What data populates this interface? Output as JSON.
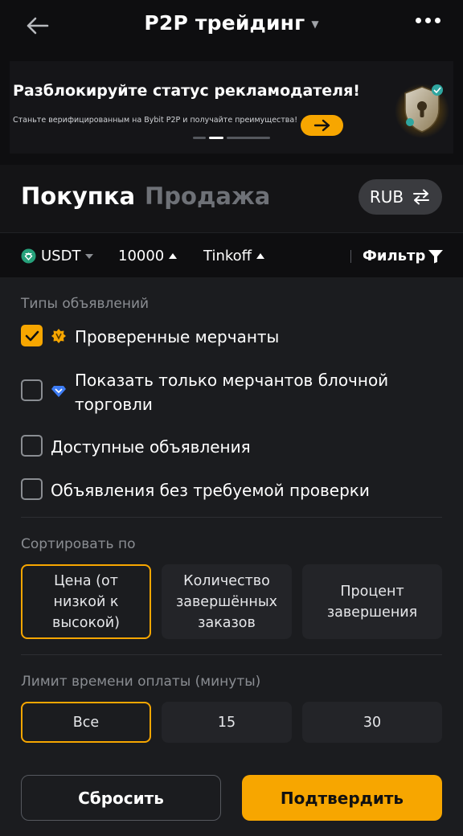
{
  "header": {
    "title": "P2P трейдинг",
    "back_icon": "arrow-left-icon",
    "more_icon": "more-horizontal-icon"
  },
  "banner": {
    "title": "Разблокируйте статус рекламодателя!",
    "subtitle": "Станьте верифицированным на Bybit P2P и получайте преимущества!",
    "cta_icon": "arrow-right-icon",
    "art_icon": "lock-badge-icon"
  },
  "tabs": {
    "buy": "Покупка",
    "sell": "Продажа",
    "active": "buy"
  },
  "currency": {
    "label": "RUB",
    "icon": "swap-icon"
  },
  "filters": {
    "coin": "USDT",
    "amount": "10000",
    "payment": "Tinkoff",
    "filter_label": "Фильтр"
  },
  "ad_types": {
    "label": "Типы объявлений",
    "items": [
      {
        "label": "Проверенные мерчанты",
        "checked": true
      },
      {
        "label": "Показать только мерчантов блочной торговли",
        "checked": false
      },
      {
        "label": "Доступные объявления",
        "checked": false
      },
      {
        "label": "Объявления без требуемой проверки",
        "checked": false
      }
    ]
  },
  "sort": {
    "label": "Сортировать по",
    "options": [
      "Цена (от низкой к высокой)",
      "Количество завершённых заказов",
      "Процент завершения"
    ],
    "selected": 0
  },
  "time_limit": {
    "label": "Лимит времени оплаты (минуты)",
    "options": [
      "Все",
      "15",
      "30"
    ],
    "selected": 0
  },
  "actions": {
    "reset": "Сбросить",
    "confirm": "Подтвердить"
  },
  "colors": {
    "accent": "#f7a600",
    "background": "#0e0e10",
    "panel": "#1b1c1f"
  }
}
